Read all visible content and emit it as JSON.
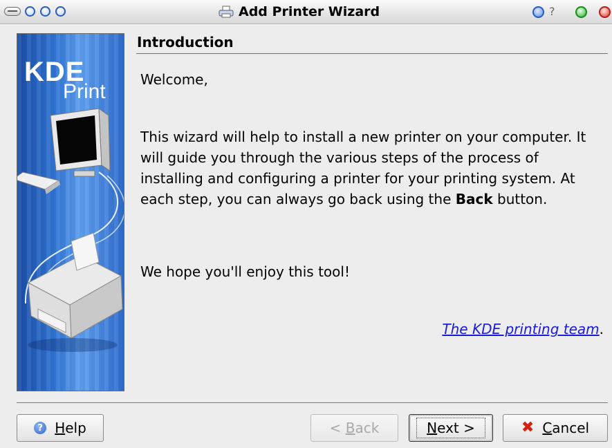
{
  "window": {
    "title": "Add Printer Wizard",
    "help_glyph": "?"
  },
  "side_banner": {
    "brand_top": "KDE",
    "brand_bottom": "Print"
  },
  "page": {
    "heading": "Introduction",
    "welcome": "Welcome,",
    "body_pre": "This wizard will help to install a new printer on your computer. It will guide you through the various steps of the process of installing and configuring a printer for your printing system. At each step, you can always go back using the ",
    "body_bold": "Back",
    "body_post": " button.",
    "enjoy": "We hope you'll enjoy this tool!",
    "signature_link": "The KDE printing team",
    "signature_end": "."
  },
  "buttons": {
    "help": {
      "mnemonic": "H",
      "rest": "elp"
    },
    "back": {
      "prefix": "< ",
      "mnemonic": "B",
      "rest": "ack"
    },
    "next": {
      "mnemonic": "N",
      "rest": "ext >"
    },
    "cancel": {
      "mnemonic": "C",
      "rest": "ancel"
    }
  },
  "colors": {
    "link": "#1a1ae0",
    "disabled_text": "#a9a9a9",
    "banner_blue": "#2f74d4",
    "cancel_red": "#d82010"
  }
}
